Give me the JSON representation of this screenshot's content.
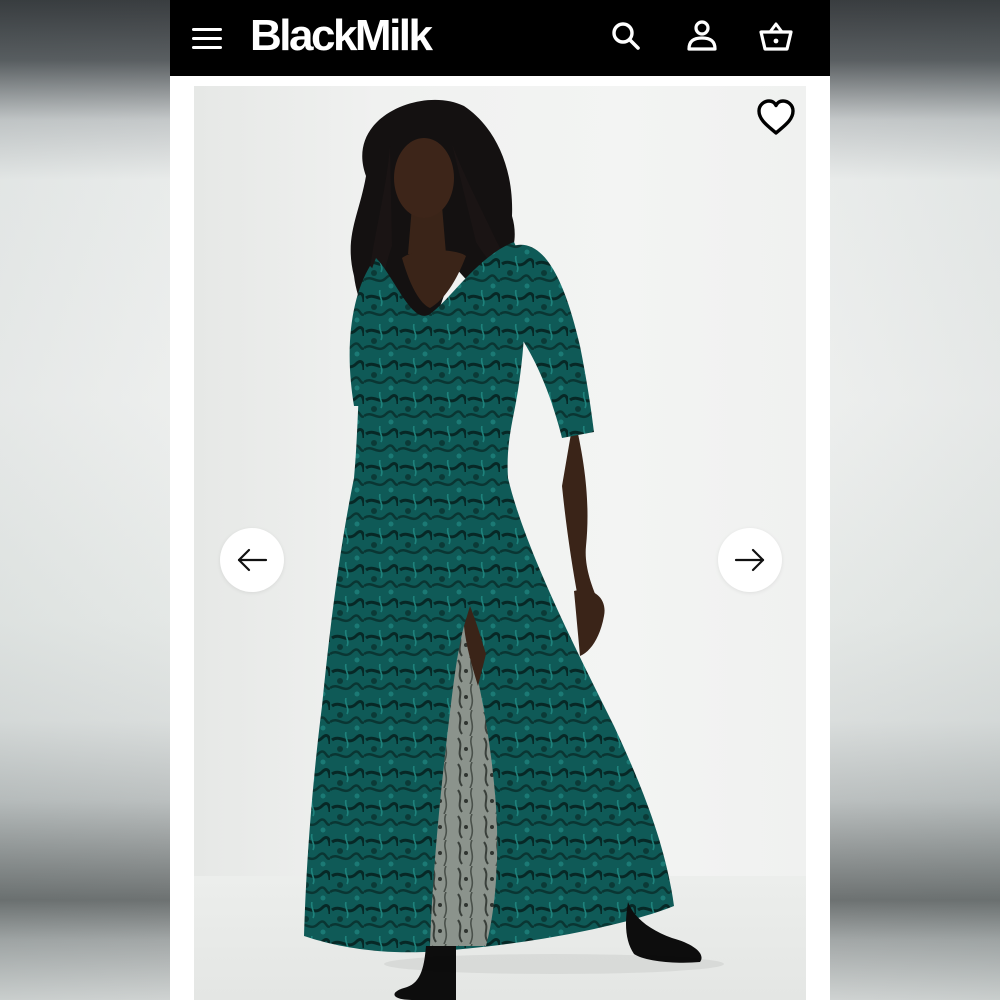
{
  "header": {
    "brand": "BlackMilk",
    "menu_icon": "hamburger-menu-icon",
    "search_icon": "search-icon",
    "account_icon": "account-icon",
    "basket_icon": "basket-icon"
  },
  "gallery": {
    "image_alt": "",
    "favorite_icon": "heart-icon",
    "prev_icon": "arrow-left-icon",
    "next_icon": "arrow-right-icon"
  },
  "colors": {
    "header_bg": "#000000",
    "dress": "#0f5a57",
    "backdrop": "#f2f3f2"
  }
}
